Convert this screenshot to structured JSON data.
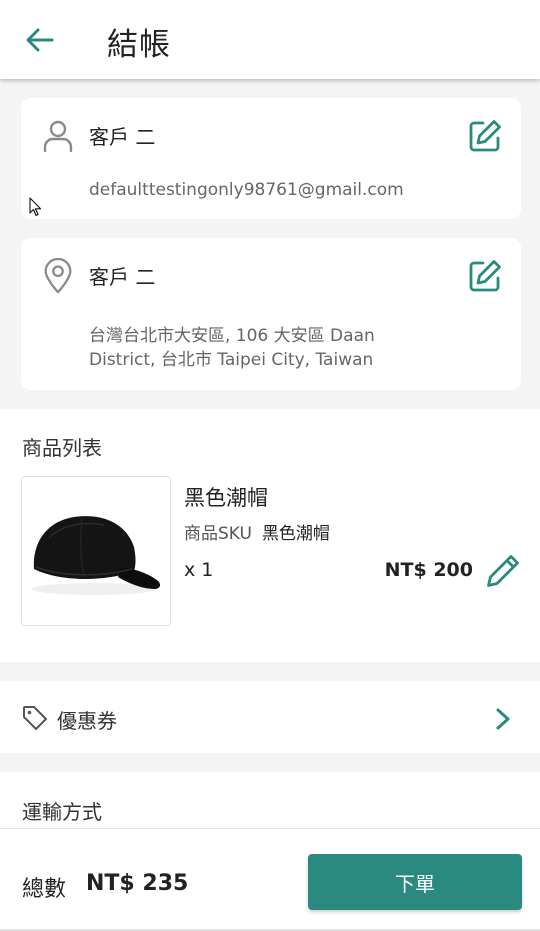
{
  "header": {
    "title": "結帳"
  },
  "customer": {
    "name": "客戶 二",
    "email": "defaulttestingonly98761@gmail.com"
  },
  "address": {
    "name": "客戶 二",
    "line1": "台灣台北市大安區, 106 大安區 Daan",
    "line2": "District, 台北市 Taipei City, Taiwan"
  },
  "products": {
    "title": "商品列表",
    "items": [
      {
        "name": "黑色潮帽",
        "sku_label": "商品SKU",
        "sku_value": "黑色潮帽",
        "qty": "x 1",
        "price": "NT$ 200"
      }
    ]
  },
  "coupon": {
    "label": "優惠券"
  },
  "shipping": {
    "title": "運輸方式"
  },
  "footer": {
    "total_label": "總數",
    "total_value": "NT$ 235",
    "order_button": "下單"
  },
  "colors": {
    "accent": "#2b8a80",
    "icon_gray": "#8a8a8a",
    "background": "#f4f4f4"
  },
  "icons": {
    "back": "arrow-left-icon",
    "person": "person-icon",
    "location": "location-pin-icon",
    "edit": "edit-square-icon",
    "pencil": "pencil-icon",
    "tag": "tag-icon",
    "chevron": "chevron-right-icon"
  }
}
